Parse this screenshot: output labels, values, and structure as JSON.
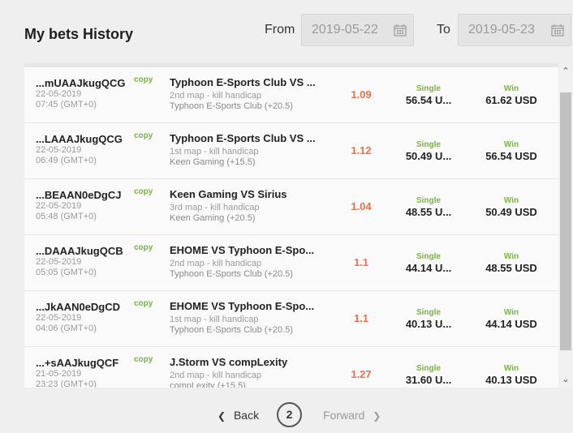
{
  "header": {
    "title": "My bets History",
    "from_label": "From",
    "from_value": "2019-05-22",
    "to_label": "To",
    "to_value": "2019-05-23"
  },
  "bets": [
    {
      "id": "...mUAAJkugQCG",
      "copy": "copy",
      "date": "22-05-2019",
      "time": "07:45 (GMT+0)",
      "match": "Typhoon E-Sports Club VS ...",
      "market": "2nd map - kill handicap",
      "pick": "Typhoon E-Sports Club (+20.5)",
      "odds": "1.09",
      "bet_type": "Single",
      "stake": "56.54 U...",
      "result": "Win",
      "payout": "61.62 USD"
    },
    {
      "id": "...LAAAJkugQCG",
      "copy": "copy",
      "date": "22-05-2019",
      "time": "06:49 (GMT+0)",
      "match": "Typhoon E-Sports Club VS ...",
      "market": "1st map - kill handicap",
      "pick": "Keen Gaming (+15.5)",
      "odds": "1.12",
      "bet_type": "Single",
      "stake": "50.49 U...",
      "result": "Win",
      "payout": "56.54 USD"
    },
    {
      "id": "...BEAAN0eDgCJ",
      "copy": "copy",
      "date": "22-05-2019",
      "time": "05:48 (GMT+0)",
      "match": "Keen Gaming VS Sirius",
      "market": "3rd map - kill handicap",
      "pick": "Keen Gaming (+20.5)",
      "odds": "1.04",
      "bet_type": "Single",
      "stake": "48.55 U...",
      "result": "Win",
      "payout": "50.49 USD"
    },
    {
      "id": "...DAAAJkugQCB",
      "copy": "copy",
      "date": "22-05-2019",
      "time": "05:05 (GMT+0)",
      "match": "EHOME VS Typhoon E-Spo...",
      "market": "2nd map - kill handicap",
      "pick": "Typhoon E-Sports Club (+20.5)",
      "odds": "1.1",
      "bet_type": "Single",
      "stake": "44.14 U...",
      "result": "Win",
      "payout": "48.55 USD"
    },
    {
      "id": "...JkAAN0eDgCD",
      "copy": "copy",
      "date": "22-05-2019",
      "time": "04:06 (GMT+0)",
      "match": "EHOME VS Typhoon E-Spo...",
      "market": "1st map - kill handicap",
      "pick": "Typhoon E-Sports Club (+20.5)",
      "odds": "1.1",
      "bet_type": "Single",
      "stake": "40.13 U...",
      "result": "Win",
      "payout": "44.14 USD"
    },
    {
      "id": "...+sAAJkugQCF",
      "copy": "copy",
      "date": "21-05-2019",
      "time": "23:23 (GMT+0)",
      "match": "J.Storm VS compLexity",
      "market": "2nd map - kill handicap",
      "pick": "compLexity (+15.5)",
      "odds": "1.27",
      "bet_type": "Single",
      "stake": "31.60 U...",
      "result": "Win",
      "payout": "40.13 USD"
    }
  ],
  "pagination": {
    "back_label": "Back",
    "current_page": "2",
    "forward_label": "Forward"
  },
  "colors": {
    "accent_green": "#7cb342",
    "odds_orange": "#e8724f"
  }
}
